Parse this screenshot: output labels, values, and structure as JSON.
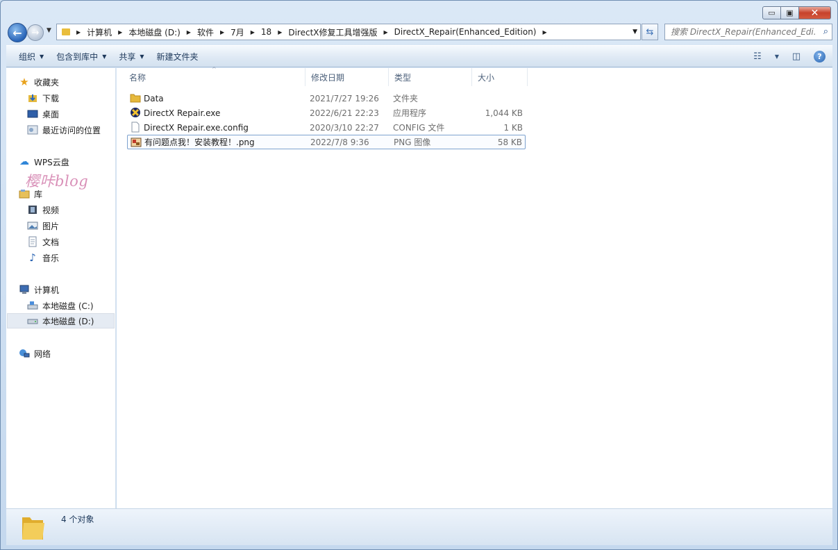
{
  "window": {
    "min_glyph": "▭",
    "max_glyph": "▣",
    "close_glyph": "✕"
  },
  "address": {
    "crumbs": [
      "计算机",
      "本地磁盘 (D:)",
      "软件",
      "7月",
      "18",
      "DirectX修复工具增强版",
      "DirectX_Repair(Enhanced_Edition)"
    ],
    "sep": "▶"
  },
  "search": {
    "placeholder": "搜索 DirectX_Repair(Enhanced_Edi..."
  },
  "toolbar": {
    "organize": "组织",
    "include_in_library": "包含到库中",
    "share": "共享",
    "new_folder": "新建文件夹",
    "arrow": "▼",
    "help": "?"
  },
  "sidebar": {
    "favorites": "收藏夹",
    "downloads": "下载",
    "desktop": "桌面",
    "recent": "最近访问的位置",
    "wps": "WPS云盘",
    "watermark": "樱咔blog",
    "libraries": "库",
    "videos": "视频",
    "pictures": "图片",
    "documents": "文档",
    "music": "音乐",
    "computer": "计算机",
    "drive_c": "本地磁盘 (C:)",
    "drive_d": "本地磁盘 (D:)",
    "network": "网络"
  },
  "columns": {
    "name": "名称",
    "date": "修改日期",
    "type": "类型",
    "size": "大小"
  },
  "files": [
    {
      "name": "Data",
      "date": "2021/7/27 19:26",
      "type": "文件夹",
      "size": "",
      "icon": "folder-icon"
    },
    {
      "name": "DirectX Repair.exe",
      "date": "2022/6/21 22:23",
      "type": "应用程序",
      "size": "1,044 KB",
      "icon": "directx-app-icon"
    },
    {
      "name": "DirectX Repair.exe.config",
      "date": "2020/3/10 22:27",
      "type": "CONFIG 文件",
      "size": "1 KB",
      "icon": "document-icon"
    },
    {
      "name": "有问题点我！安装教程！.png",
      "date": "2022/7/8 9:36",
      "type": "PNG 图像",
      "size": "58 KB",
      "icon": "image-icon"
    }
  ],
  "status": {
    "count": "4 个对象"
  }
}
